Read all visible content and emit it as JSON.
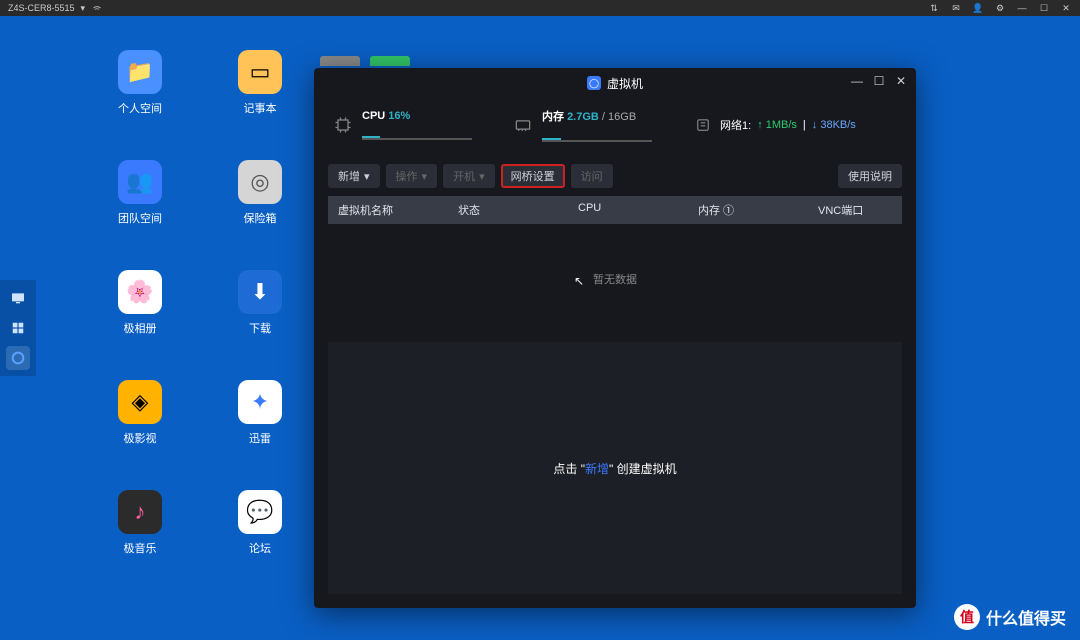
{
  "topbar": {
    "hostname": "Z4S-CER8-5515"
  },
  "desktop": [
    {
      "name": "personal-space",
      "label": "个人空间",
      "bg": "#4a90ff",
      "glyph": "📁"
    },
    {
      "name": "notepad",
      "label": "记事本",
      "bg": "#ffc357",
      "glyph": "📝"
    },
    {
      "name": "team-space",
      "label": "团队空间",
      "bg": "#3a7aff",
      "glyph": "📂"
    },
    {
      "name": "vault",
      "label": "保险箱",
      "bg": "#d5d5d5",
      "glyph": "◎"
    },
    {
      "name": "album",
      "label": "极相册",
      "bg": "#ffffff",
      "glyph": "🌸"
    },
    {
      "name": "download",
      "label": "下载",
      "bg": "#1e6bd6",
      "glyph": "🌐"
    },
    {
      "name": "video",
      "label": "极影视",
      "bg": "#ffb300",
      "glyph": "💠"
    },
    {
      "name": "xunlei",
      "label": "迅雷",
      "bg": "#ffffff",
      "glyph": "🐦"
    },
    {
      "name": "music",
      "label": "极音乐",
      "bg": "#2b2b2b",
      "glyph": "🎵"
    },
    {
      "name": "forum",
      "label": "论坛",
      "bg": "#ffffff",
      "glyph": "💬"
    }
  ],
  "vm": {
    "title": "虚拟机",
    "stats": {
      "cpu_label": "CPU",
      "cpu_val": "16%",
      "mem_label": "内存",
      "mem_val": "2.7GB",
      "mem_total": "/ 16GB",
      "net_label": "网络1:",
      "net_up": "↑ 1MB/s",
      "net_down": "↓ 38KB/s"
    },
    "toolbar": {
      "add": "新增",
      "operate": "操作",
      "power": "开机",
      "bridge": "网桥设置",
      "visit": "访问",
      "help": "使用说明"
    },
    "table": {
      "cols": {
        "name": "虚拟机名称",
        "status": "状态",
        "cpu": "CPU",
        "mem": "内存 ①",
        "vnc": "VNC端口"
      },
      "empty": "暂无数据"
    },
    "prompt_pre": "点击 \"",
    "prompt_kw": "新增",
    "prompt_post": "\" 创建虚拟机"
  },
  "watermark": "什么值得买"
}
